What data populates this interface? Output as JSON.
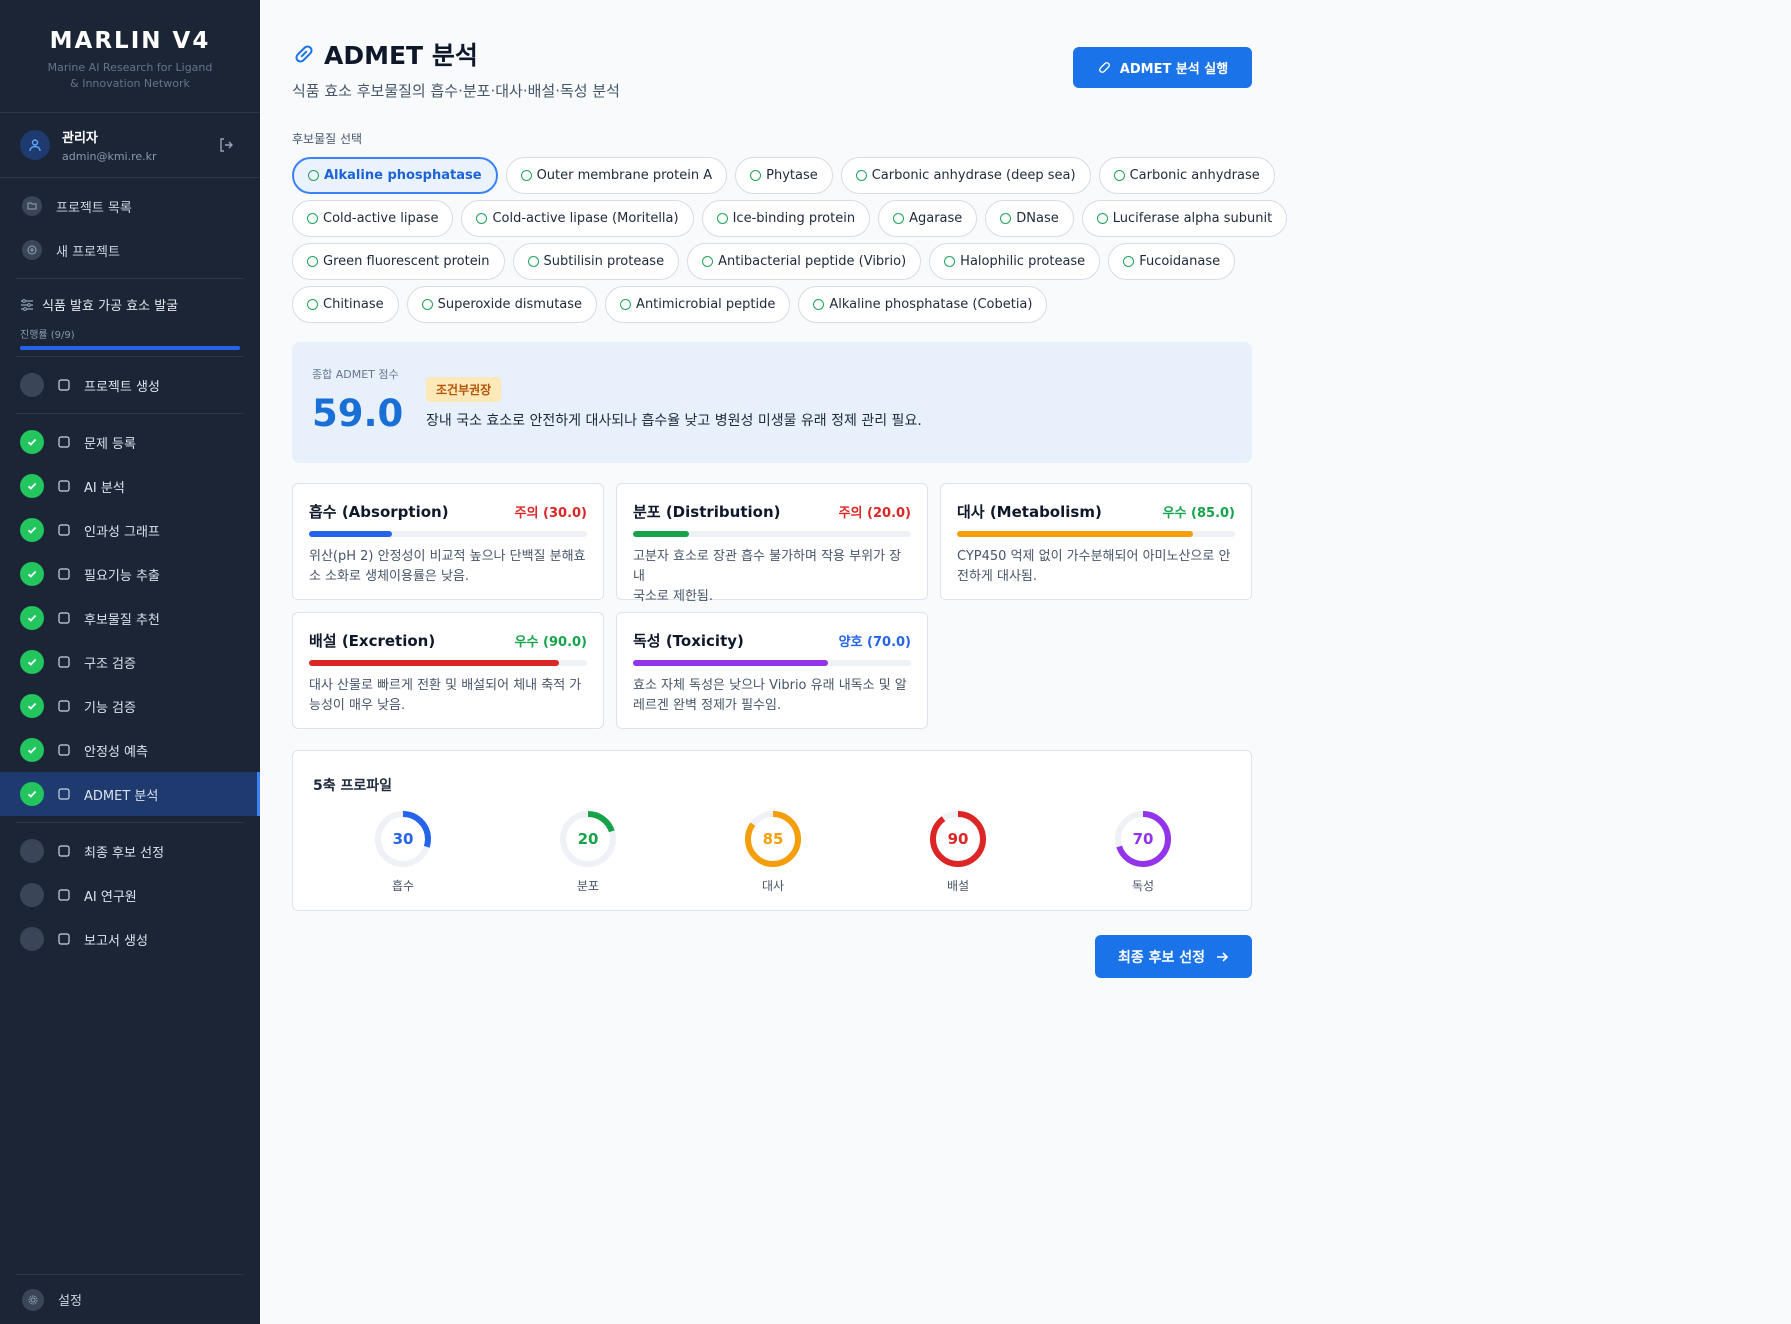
{
  "brand": {
    "title": "MARLIN V4",
    "subtitle_line1": "Marine AI Research for Ligand",
    "subtitle_line2": "& Innovation Network"
  },
  "user": {
    "name": "관리자",
    "email": "admin@kmi.re.kr"
  },
  "nav": {
    "project_list": "프로젝트 목록",
    "new_project": "새 프로젝트"
  },
  "project": {
    "title": "식품 발효 가공 효소 발굴",
    "progress_label": "진행률 (9/9)",
    "progress": 1.0
  },
  "steps": [
    {
      "label": "프로젝트 생성",
      "done": false,
      "icon": "clipboard-icon"
    },
    {
      "label": "문제 등록",
      "done": true,
      "icon": "document-icon"
    },
    {
      "label": "AI 분석",
      "done": true,
      "icon": "cpu-icon"
    },
    {
      "label": "인과성 그래프",
      "done": true,
      "icon": "graph-icon"
    },
    {
      "label": "필요기능 추출",
      "done": true,
      "icon": "function-icon"
    },
    {
      "label": "후보물질 추천",
      "done": true,
      "icon": "star-icon"
    },
    {
      "label": "구조 검증",
      "done": true,
      "icon": "cube-icon"
    },
    {
      "label": "기능 검증",
      "done": true,
      "icon": "flask-icon"
    },
    {
      "label": "안정성 예측",
      "done": true,
      "icon": "thermometer-icon"
    },
    {
      "label": "ADMET 분석",
      "done": true,
      "icon": "bar-chart-icon",
      "active": true
    },
    {
      "label": "최종 후보 선정",
      "done": false,
      "icon": "message-icon"
    },
    {
      "label": "AI 연구원",
      "done": false,
      "icon": "copy-icon"
    },
    {
      "label": "보고서 생성",
      "done": false,
      "icon": "clipboard-icon"
    }
  ],
  "settings_label": "설정",
  "header": {
    "title": "ADMET 분석",
    "subtitle": "식품 효소 후보물질의 흡수·분포·대사·배설·독성 분석",
    "run_button": "ADMET 분석 실행"
  },
  "candidates": {
    "label": "후보물질 선택",
    "rows": [
      [
        "Alkaline phosphatase",
        "Outer membrane protein A",
        "Phytase",
        "Carbonic anhydrase (deep sea)",
        "Carbonic anhydrase"
      ],
      [
        "Cold-active lipase",
        "Cold-active lipase (Moritella)",
        "Ice-binding protein",
        "Agarase",
        "DNase",
        "Luciferase alpha subunit"
      ],
      [
        "Green fluorescent protein",
        "Subtilisin protease",
        "Antibacterial peptide (Vibrio)",
        "Halophilic protease",
        "Fucoidanase"
      ],
      [
        "Chitinase",
        "Superoxide dismutase",
        "Antimicrobial peptide",
        "Alkaline phosphatase (Cobetia)"
      ]
    ],
    "selected": "Alkaline phosphatase"
  },
  "summary": {
    "label": "종합 ADMET 점수",
    "score": "59.0",
    "badge": "조건부권장",
    "description": "장내 국소 효소로 안전하게 대사되나 흡수율 낮고 병원성 미생물 유래 정제 관리 필요."
  },
  "cards": [
    {
      "title": "흡수 (Absorption)",
      "grade": "주의 (30.0)",
      "value": 30,
      "color": "#2563eb",
      "grade_color": "#dc2626",
      "line1": "위산(pH 2) 안정성이 비교적 높으나 단백질 분해효",
      "line2": "소 소화로 생체이용률은 낮음."
    },
    {
      "title": "분포 (Distribution)",
      "grade": "주의 (20.0)",
      "value": 20,
      "color": "#16a34a",
      "grade_color": "#dc2626",
      "line1": "고분자 효소로 장관 흡수 불가하며 작용 부위가 장내",
      "line2": "국소로 제한됨."
    },
    {
      "title": "대사 (Metabolism)",
      "grade": "우수 (85.0)",
      "value": 85,
      "color": "#f59e0b",
      "grade_color": "#16a34a",
      "line1": "CYP450 억제 없이 가수분해되어 아미노산으로 안",
      "line2": "전하게 대사됨."
    },
    {
      "title": "배설 (Excretion)",
      "grade": "우수 (90.0)",
      "value": 90,
      "color": "#dc2626",
      "grade_color": "#16a34a",
      "line1": "대사 산물로 빠르게 전환 및 배설되어 체내 축적 가",
      "line2": "능성이 매우 낮음."
    },
    {
      "title": "독성 (Toxicity)",
      "grade": "양호 (70.0)",
      "value": 70,
      "color": "#9333ea",
      "grade_color": "#2563eb",
      "line1": "효소 자체 독성은 낮으나 Vibrio 유래 내독소 및 알",
      "line2": "레르겐 완벽 정제가 필수임."
    }
  ],
  "profile": {
    "title": "5축 프로파일",
    "gauges": [
      {
        "label": "흡수",
        "value": 30,
        "text": "30",
        "color": "#2563eb"
      },
      {
        "label": "분포",
        "value": 20,
        "text": "20",
        "color": "#16a34a"
      },
      {
        "label": "대사",
        "value": 85,
        "text": "85",
        "color": "#f59e0b"
      },
      {
        "label": "배설",
        "value": 90,
        "text": "90",
        "color": "#dc2626"
      },
      {
        "label": "독성",
        "value": 70,
        "text": "70",
        "color": "#9333ea"
      }
    ]
  },
  "next_button": "최종 후보 선정"
}
